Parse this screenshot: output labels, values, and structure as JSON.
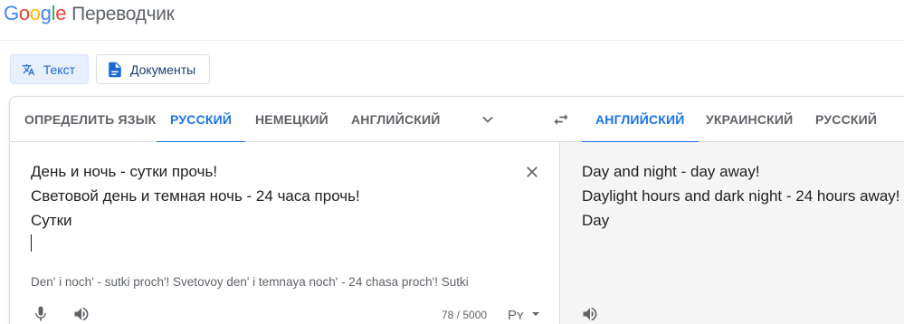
{
  "logo": {
    "brand_letters": [
      "G",
      "o",
      "o",
      "g",
      "l",
      "e"
    ],
    "product": "Переводчик"
  },
  "modes": [
    {
      "label": "Текст",
      "icon": "translate-icon",
      "active": true
    },
    {
      "label": "Документы",
      "icon": "document-icon",
      "active": false
    }
  ],
  "source_langs": [
    "ОПРЕДЕЛИТЬ ЯЗЫК",
    "РУССКИЙ",
    "НЕМЕЦКИЙ",
    "АНГЛИЙСКИЙ"
  ],
  "target_langs": [
    "АНГЛИЙСКИЙ",
    "УКРАИНСКИЙ",
    "РУССКИЙ"
  ],
  "selected": {
    "source": "РУССКИЙ",
    "target": "АНГЛИЙСКИЙ"
  },
  "source": {
    "lines": [
      "День и ночь - сутки прочь!",
      "Световой день и темная ночь - 24 часа прочь!",
      "Сутки"
    ],
    "transliteration": "Den' i noch' - sutki proch'! Svetovoy den' i temnaya noch' - 24 chasa proch'! Sutki",
    "char_count": "78 / 5000"
  },
  "target": {
    "lines": [
      "Day and night - day away!",
      "Daylight hours and dark night - 24 hours away!",
      "Day"
    ]
  },
  "colors": {
    "accent": "#1a73e8",
    "text": "#202124",
    "muted": "#5f6368",
    "target_bg": "#f5f5f5"
  }
}
